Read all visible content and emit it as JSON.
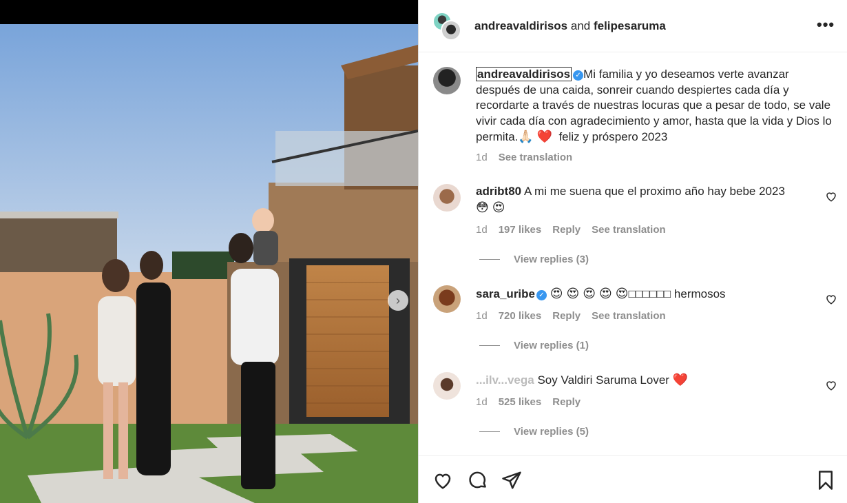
{
  "header": {
    "user1": "andreavaldirisos",
    "joiner": "and",
    "user2": "felipesaruma"
  },
  "caption": {
    "username": "andreavaldirisos",
    "text": "Mi familia y yo deseamos verte avanzar después de una caida, sonreir cuando despiertes cada día y recordarte a través de nuestras locuras que a pesar de todo, se vale vivir cada día con agradecimiento y amor, hasta que la vida y Dios lo permita.",
    "emoji_praying": "🙏🏻",
    "emoji_heart": "❤️",
    "text_end": "feliz y próspero 2023",
    "time": "1d",
    "see_translation": "See translation"
  },
  "comments": [
    {
      "username": "adribt80",
      "text": "A mi me suena que el proximo año hay bebe 2023",
      "emojis": "😳 😍",
      "time": "1d",
      "likes": "197 likes",
      "reply": "Reply",
      "see_translation": "See translation",
      "view_replies": "View replies (3)"
    },
    {
      "username": "sara_uribe",
      "emojis": "😍 😍 😍 😍 😍",
      "boxes": "□□□□□□",
      "text": "hermosos",
      "time": "1d",
      "likes": "720 likes",
      "reply": "Reply",
      "see_translation": "See translation",
      "view_replies": "View replies (1)"
    },
    {
      "username": "...ilv...vega",
      "text": "Soy Valdiri Saruma Lover",
      "emoji": "❤️",
      "time": "1d",
      "likes": "525 likes",
      "reply": "Reply",
      "view_replies": "View replies (5)"
    }
  ],
  "colors": {
    "verified": "#3897f0",
    "text": "#262626",
    "muted": "#8e8e8e",
    "heart": "#ed1c24"
  }
}
